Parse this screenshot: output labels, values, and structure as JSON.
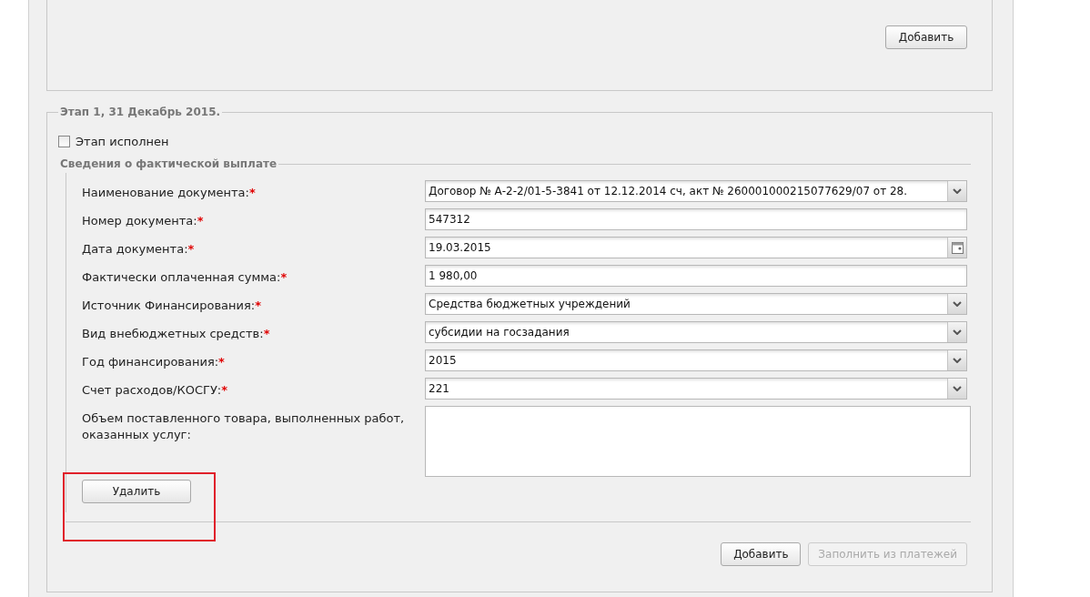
{
  "top_section": {
    "add_button": {
      "label": "Добавить"
    }
  },
  "stage": {
    "title": "Этап 1, 31 Декабрь 2015.",
    "completed": {
      "label": "Этап исполнен",
      "checked": false
    },
    "payment": {
      "title": "Сведения о фактической выплате",
      "fields": [
        {
          "kind": "select",
          "label": "Наименование документа:",
          "required_mark": "*",
          "value": "Договор № А-2-2/01-5-3841 от 12.12.2014 сч, акт № 260001000215077629/07 от 28."
        },
        {
          "kind": "text",
          "label": "Номер документа:",
          "required_mark": "*",
          "value": "547312"
        },
        {
          "kind": "date",
          "label": "Дата документа:",
          "required_mark": "*",
          "value": "19.03.2015"
        },
        {
          "kind": "text",
          "label": "Фактически оплаченная сумма:",
          "required_mark": "*",
          "value": "1 980,00"
        },
        {
          "kind": "select",
          "label": "Источник Финансирования:",
          "required_mark": "*",
          "value": "Средства бюджетных учреждений"
        },
        {
          "kind": "select",
          "label": "Вид внебюджетных средств:",
          "required_mark": "*",
          "value": "субсидии на госзадания"
        },
        {
          "kind": "select",
          "label": "Год финансирования:",
          "required_mark": "*",
          "value": "2015"
        },
        {
          "kind": "select",
          "label": "Счет расходов/КОСГУ:",
          "required_mark": "*",
          "value": "221"
        },
        {
          "kind": "textarea",
          "label": "Объем поставленного товара, выполненных работ, оказанных услуг:"
        }
      ],
      "delete_button": {
        "label": "Удалить"
      }
    },
    "buttons": [
      {
        "label": "Добавить",
        "disabled": false
      },
      {
        "label": "Заполнить из платежей",
        "disabled": true
      }
    ]
  }
}
